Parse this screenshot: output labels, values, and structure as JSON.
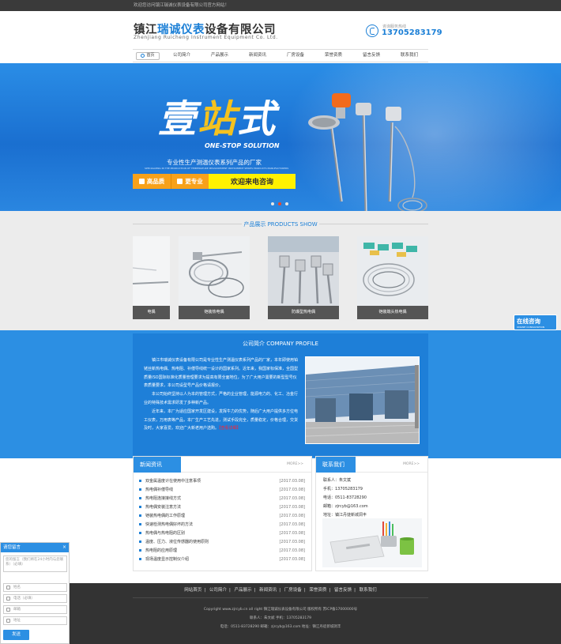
{
  "topbar": {
    "welcome": "欢迎您访问镇江瑞诚仪表设备有限公司官方网站！"
  },
  "header": {
    "logo_cn_pre": "镇江",
    "logo_cn_hl": "瑞诚仪表",
    "logo_cn_post": "设备有限公司",
    "logo_en": "Zhenjiang Ruicheng Instrument Equipment Co. Ltd.",
    "phone_label": "咨询服务热线",
    "phone": "13705283179"
  },
  "nav": {
    "home": "首页",
    "items": [
      "公司简介",
      "产品展示",
      "新闻资讯",
      "厂房设备",
      "荣誉资质",
      "留言反馈",
      "联系我们"
    ]
  },
  "banner": {
    "big_a": "壹",
    "big_b": "站",
    "big_c": "式",
    "en": "ONE-STOP SOLUTION",
    "sub": "专业性生产测温仪表系列产品的厂家",
    "sub_en": "SPECIALIZING IN THE PRODUCTION OF TEMPERATURE MEASUREMENT INSTRUMENT SERIES PRODUCTS MANUFACTURERS",
    "btn_quality": "高品质",
    "btn_pro": "更专业",
    "btn_consult": "欢迎来电咨询"
  },
  "products": {
    "title": "产品展示 PRODUCTS SHOW",
    "items": [
      {
        "caption": "电偶"
      },
      {
        "caption": "铠装热电偶"
      },
      {
        "caption": "防爆型热电偶"
      },
      {
        "caption": "铠装端头热电偶"
      }
    ]
  },
  "company": {
    "title": "公司简介 COMPANY PROFILE",
    "p1": "镇江市瑞诚仪表设备有限公司是专业性生产测温仪表系列产品的厂家，本年即使用铂铑丝新热电偶、热电阻、补偿导线统一设计的国家系列。近年来，我国家标保准，全国型质量ISO国际标准化质量管理要求为提高有限全面地位，为了广大用户需要的新型型号仪表质量要求，本公司设型号产品价格请报价。",
    "p2": "本公司始终坚持以人为本的管理方式，严格的企业管理，能源电力的、化工、冶金行业的特殊技术需求研发了多种新产品。",
    "p3": "近年来，本厂为适应国家开发区建设，发挥牛力的优势，随后广大用户提供多方位电工仪表，万用表等产品，本厂生产工艺先进，测试手段完全，质量稳定，价格合理，交货及时，大家喜爱。欢迎广大新老用户选购。",
    "more": "【查看详细】"
  },
  "news": {
    "title": "新闻资讯",
    "more": "MORE>>",
    "items": [
      {
        "t": "双金属温度计在使用中注意事项",
        "d": "[2017.03.08]"
      },
      {
        "t": "热电偶补偿导线",
        "d": "[2017.03.08]"
      },
      {
        "t": "热电阻连接接线方式",
        "d": "[2017.03.08]"
      },
      {
        "t": "热电偶安装注意方法",
        "d": "[2017.03.08]"
      },
      {
        "t": "铠装热电偶的工作原理",
        "d": "[2017.03.08]"
      },
      {
        "t": "快速检测热电偶好坏的方法",
        "d": "[2017.03.08]"
      },
      {
        "t": "热电偶与热电阻的区别",
        "d": "[2017.03.08]"
      },
      {
        "t": "温度、压力、液位传感器的使用原则",
        "d": "[2017.03.08]"
      },
      {
        "t": "热电阻的应用原理",
        "d": "[2017.03.08]"
      },
      {
        "t": "现场温度显示控制仪介绍",
        "d": "[2017.03.08]"
      }
    ]
  },
  "contact": {
    "title": "联系我们",
    "more": "MORE>>",
    "person": "联系人：朱文斌",
    "mobile": "手机：13705283179",
    "tel": "电话：0511-83728290",
    "email": "邮箱：zjrcyb@163.com",
    "addr": "地址：镇江丹徒新城洞丰"
  },
  "footer": {
    "nav": [
      "网站首页",
      "公司简介",
      "产品展示",
      "新闻资讯",
      "厂房设备",
      "荣誉资质",
      "留言反馈",
      "联系我们"
    ],
    "copy": "Copyright www.zjrcyb.cn all right 镇江瑞诚仪表设备有限公司 版权所有 苏ICP备17000000号",
    "addr1": "联系人：朱文斌 手机：13705283179",
    "addr2": "电话：0511-83728290 邮箱：zjrcyb@163.com 地址：镇江丹徒新城洞丰"
  },
  "online": {
    "title": "在线咨询",
    "sub": "ONLINE CONSULTATION"
  },
  "message": {
    "title": "请您留言",
    "close": "×",
    "placeholder": "您的留言（我们将在24小时内与您联系）（必填）",
    "name": "姓名",
    "phone": "电话（必填）",
    "email": "邮箱",
    "addr": "地址",
    "send": "发送"
  }
}
